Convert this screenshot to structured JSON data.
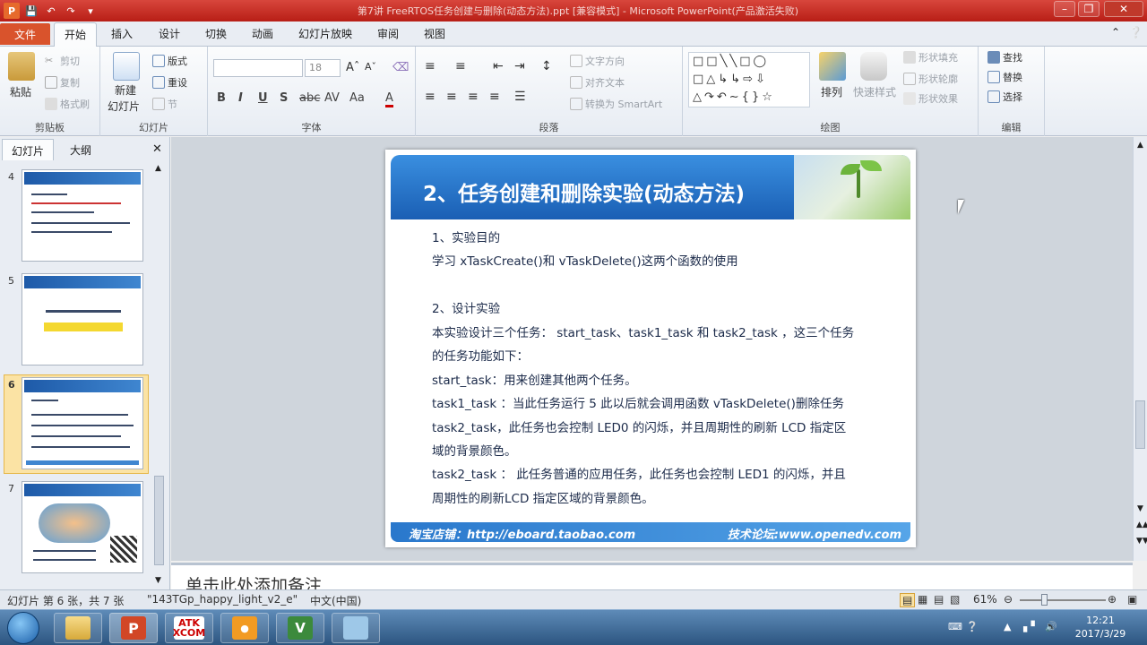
{
  "window": {
    "title": "第7讲 FreeRTOS任务创建与删除(动态方法).ppt [兼容模式] - Microsoft PowerPoint(产品激活失败)"
  },
  "menu": {
    "file": "文件",
    "tabs": [
      "开始",
      "插入",
      "设计",
      "切换",
      "动画",
      "幻灯片放映",
      "审阅",
      "视图"
    ]
  },
  "ribbon": {
    "clipboard": {
      "label": "剪贴板",
      "paste": "粘贴",
      "cut": "剪切",
      "copy": "复制",
      "format_painter": "格式刷"
    },
    "slides": {
      "label": "幻灯片",
      "new_slide": "新建",
      "new_slide2": "幻灯片",
      "layout": "版式",
      "reset": "重设",
      "section": "节"
    },
    "font": {
      "label": "字体",
      "font_size": "18"
    },
    "paragraph": {
      "label": "段落",
      "text_direction": "文字方向",
      "align_text": "对齐文本",
      "smartart": "转换为 SmartArt"
    },
    "drawing": {
      "label": "绘图",
      "arrange": "排列",
      "quick_styles": "快速样式",
      "shape_fill": "形状填充",
      "shape_outline": "形状轮廓",
      "shape_effects": "形状效果"
    },
    "editing": {
      "label": "编辑",
      "find": "查找",
      "replace": "替换",
      "select": "选择"
    }
  },
  "left_pane": {
    "tabs": [
      "幻灯片",
      "大纲"
    ],
    "thumbnails": [
      "4",
      "5",
      "6",
      "7"
    ],
    "selected": "6"
  },
  "slide": {
    "title": "2、任务创建和删除实验(动态方法)",
    "lines": [
      "1、实验目的",
      "学习 xTaskCreate()和 vTaskDelete()这两个函数的使用",
      "",
      "2、设计实验",
      "本实验设计三个任务： start_task、task1_task 和 task2_task ，这三个任务",
      "的任务功能如下：",
      "start_task：用来创建其他两个任务。",
      "task1_task ：当此任务运行 5 此以后就会调用函数 vTaskDelete()删除任务",
      "task2_task，此任务也会控制 LED0 的闪烁，并且周期性的刷新 LCD 指定区",
      "域的背景颜色。",
      "task2_task ： 此任务普通的应用任务，此任务也会控制 LED1 的闪烁，并且",
      "周期性的刷新LCD 指定区域的背景颜色。"
    ],
    "footer_left": "淘宝店铺：http://eboard.taobao.com",
    "footer_right": "技术论坛:www.openedv.com"
  },
  "notes": {
    "placeholder": "单击此处添加备注"
  },
  "status": {
    "slide_info": "幻灯片 第 6 张，共 7 张",
    "theme": "\"143TGp_happy_light_v2_e\"",
    "language": "中文(中国)",
    "zoom": "61%"
  },
  "taskbar": {
    "apps": [
      "explorer",
      "powerpoint",
      "ATK XCOM",
      "pdf",
      "visual-studio",
      "notes"
    ],
    "atk_line1": "ATK",
    "atk_line2": "XCOM",
    "time": "12:21",
    "date": "2017/3/29"
  },
  "colors": {
    "titlebar": "#c6221e",
    "file_tab": "#d9532c",
    "slide_header": "#1a5fb4",
    "thumb_selected": "#fbe3a4"
  }
}
